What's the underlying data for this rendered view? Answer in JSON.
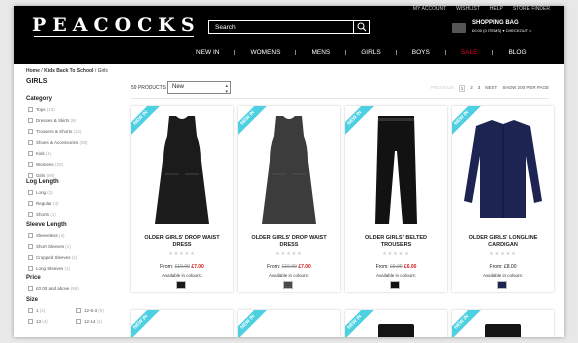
{
  "header": {
    "logo": "PEACOCKS",
    "top_links": [
      "MY ACCOUNT",
      "WISHLIST",
      "HELP",
      "STORE FINDER"
    ],
    "search_placeholder": "Search",
    "bag_title": "SHOPPING BAG",
    "bag_summary": "£0.00 (0 ITEMS) ▾ CHECKOUT >"
  },
  "nav": {
    "items": [
      "NEW IN",
      "WOMENS",
      "MENS",
      "GIRLS",
      "BOYS",
      "SALE",
      "BLOG"
    ],
    "sale_color": "#e8001c"
  },
  "breadcrumb": {
    "home": "Home",
    "sep": " / ",
    "mid": "Kids Back To School",
    "current": "Girls"
  },
  "page_title": "GIRLS",
  "filters": {
    "category": {
      "title": "Category",
      "items": [
        {
          "label": "Tops",
          "count": "(13)"
        },
        {
          "label": "Dresses & Skirts",
          "count": "(9)"
        },
        {
          "label": "Trousers & Shorts",
          "count": "(12)"
        },
        {
          "label": "Shoes & Accessories",
          "count": "(38)"
        },
        {
          "label": "Kids",
          "count": "(1)"
        },
        {
          "label": "Womens",
          "count": "(20)"
        },
        {
          "label": "Girls",
          "count": "(59)"
        }
      ]
    },
    "log_length": {
      "title": "Log Length",
      "items": [
        {
          "label": "Long",
          "count": "(2)"
        },
        {
          "label": "Regular",
          "count": "(4)"
        },
        {
          "label": "Shorts",
          "count": "(1)"
        }
      ]
    },
    "sleeve_length": {
      "title": "Sleeve Length",
      "items": [
        {
          "label": "Sleeveless",
          "count": "(4)"
        },
        {
          "label": "Short Sleeves",
          "count": "(1)"
        },
        {
          "label": "Cropped Sleeves",
          "count": "(1)"
        },
        {
          "label": "Long Sleeves",
          "count": "(1)"
        }
      ]
    },
    "price": {
      "title": "Price",
      "items": [
        {
          "label": "£0.00 and above",
          "count": "(59)"
        }
      ]
    },
    "size": {
      "title": "Size",
      "items": [
        {
          "label": "1",
          "count": "(1)"
        },
        {
          "label": "12-5-3",
          "count": "(5)"
        },
        {
          "label": "13",
          "count": "(4)"
        },
        {
          "label": "12-14",
          "count": "(1)"
        }
      ]
    }
  },
  "toolbar": {
    "product_count": "59 PRODUCTS",
    "sort_value": "New",
    "prev": "PREVIOUS",
    "pages": [
      "1",
      "2",
      "3"
    ],
    "next": "NEXT",
    "show_all": "SHOW 200 PER PAGE"
  },
  "products": [
    {
      "ribbon": "NEW IN",
      "name": "OLDER GIRLS' DROP WAIST DRESS",
      "stars": "★★★★★",
      "from": "From:",
      "was": "£10.00",
      "now": "£7.00",
      "colours": "Available in colours:",
      "swatch": "#1a1a1a",
      "garment": "dress",
      "garment_color": "#1b1b1b"
    },
    {
      "ribbon": "NEW IN",
      "name": "OLDER GIRLS' DROP WAIST DRESS",
      "stars": "★★★★★",
      "from": "From:",
      "was": "£10.00",
      "now": "£7.00",
      "colours": "Available in colours:",
      "swatch": "#4a4a4a",
      "garment": "dress",
      "garment_color": "#3c3c3c"
    },
    {
      "ribbon": "NEW IN",
      "name": "OLDER GIRLS' BELTED TROUSERS",
      "stars": "★★★★★",
      "from": "From:",
      "was": "£9.00",
      "now": "£6.00",
      "colours": "Available in colours:",
      "swatch": "#111111",
      "garment": "trousers",
      "garment_color": "#121212"
    },
    {
      "ribbon": "NEW IN",
      "name": "OLDER GIRLS' LONGLINE CARDIGAN",
      "stars": "★★★★★",
      "from": "From: £8.00",
      "was": "",
      "now": "",
      "colours": "Available in colours:",
      "swatch": "#1c2350",
      "garment": "cardigan",
      "garment_color": "#1e2452"
    }
  ]
}
